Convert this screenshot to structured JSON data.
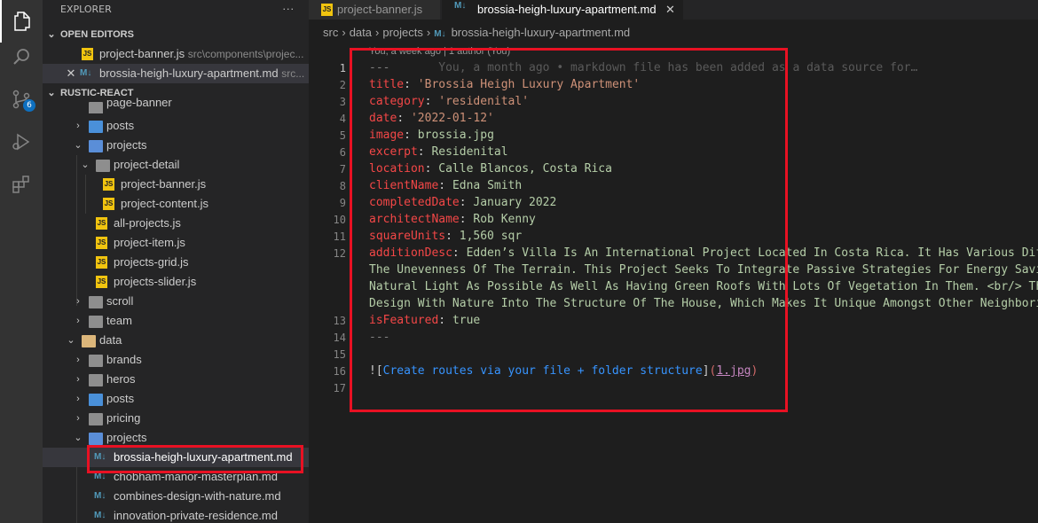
{
  "activity_bar": {
    "items": [
      "files-icon",
      "search-icon",
      "source-control-icon",
      "run-debug-icon",
      "extensions-icon"
    ],
    "scm_badge": "6"
  },
  "sidebar": {
    "title": "EXPLORER",
    "more": "···",
    "open_editors_label": "OPEN EDITORS",
    "open_editors": [
      {
        "name": "project-banner.js",
        "path": "src\\components\\projec...",
        "icon": "js"
      },
      {
        "name": "brossia-heigh-luxury-apartment.md",
        "path": "src...",
        "icon": "md"
      }
    ],
    "project_label": "RUSTIC-REACT",
    "tree": [
      {
        "label": "page-banner"
      },
      {
        "label": "posts"
      },
      {
        "label": "projects"
      },
      {
        "label": "project-detail"
      },
      {
        "label": "project-banner.js"
      },
      {
        "label": "project-content.js"
      },
      {
        "label": "all-projects.js"
      },
      {
        "label": "project-item.js"
      },
      {
        "label": "projects-grid.js"
      },
      {
        "label": "projects-slider.js"
      },
      {
        "label": "scroll"
      },
      {
        "label": "team"
      },
      {
        "label": "data"
      },
      {
        "label": "brands"
      },
      {
        "label": "heros"
      },
      {
        "label": "posts"
      },
      {
        "label": "pricing"
      },
      {
        "label": "projects"
      },
      {
        "label": "brossia-heigh-luxury-apartment.md"
      },
      {
        "label": "chobham-manor-masterplan.md"
      },
      {
        "label": "combines-design-with-nature.md"
      },
      {
        "label": "innovation-private-residence.md"
      }
    ]
  },
  "tabs": [
    {
      "label": "project-banner.js",
      "icon": "JS"
    },
    {
      "label": "brossia-heigh-luxury-apartment.md",
      "icon": "M↓",
      "close": "✕"
    }
  ],
  "breadcrumb": {
    "parts": [
      "src",
      "data",
      "projects",
      "brossia-heigh-luxury-apartment.md"
    ],
    "icon": "M↓",
    "sep": "›"
  },
  "editor": {
    "codelens": "You, a week ago | 1 author (You)",
    "line_numbers": [
      "1",
      "2",
      "3",
      "4",
      "5",
      "6",
      "7",
      "8",
      "9",
      "10",
      "11",
      "12",
      "13",
      "14",
      "15",
      "16",
      "17"
    ],
    "line1": {
      "text": "---",
      "blame": "You, a month ago • markdown file has been added as a data source for…"
    },
    "fields": [
      {
        "key": "title",
        "value": "'Brossia Heigh Luxury Apartment'",
        "kind": "s"
      },
      {
        "key": "category",
        "value": "'residenital'",
        "kind": "s"
      },
      {
        "key": "date",
        "value": "'2022-01-12'",
        "kind": "s"
      },
      {
        "key": "image",
        "value": "brossia.jpg",
        "kind": "v"
      },
      {
        "key": "excerpt",
        "value": "Residenital",
        "kind": "v"
      },
      {
        "key": "location",
        "value": "Calle Blancos, Costa Rica",
        "kind": "v"
      },
      {
        "key": "clientName",
        "value": "Edna Smith",
        "kind": "v"
      },
      {
        "key": "completedDate",
        "value": "January 2022",
        "kind": "v"
      },
      {
        "key": "architectName",
        "value": "Rob Kenny",
        "kind": "v"
      },
      {
        "key": "squareUnits",
        "value": "1,560 sqr",
        "kind": "v"
      }
    ],
    "addition": {
      "key": "additionDesc",
      "lines": [
        "Edden’s Villa Is An International Project Located In Costa Rica. It Has Various Diff",
        "The Unevenness Of The Terrain. This Project Seeks To Integrate Passive Strategies For Energy Savin",
        "Natural Light As Possible As Well As Having Green Roofs With Lots Of Vegetation In Them. <br/> The",
        "Design With Nature Into The Structure Of The House, Which Makes It Unique Amongst Other Neighborin"
      ]
    },
    "featured": {
      "key": "isFeatured",
      "value": "true"
    },
    "closing": "---",
    "image_line": {
      "bang": "![",
      "alt": "Create routes via your file + folder structure",
      "close": "]",
      "open_paren": "(",
      "src": "1.jpg",
      "close_paren": ")"
    }
  },
  "colors": {
    "highlight": "#e81123",
    "accent": "#0e70c0"
  }
}
